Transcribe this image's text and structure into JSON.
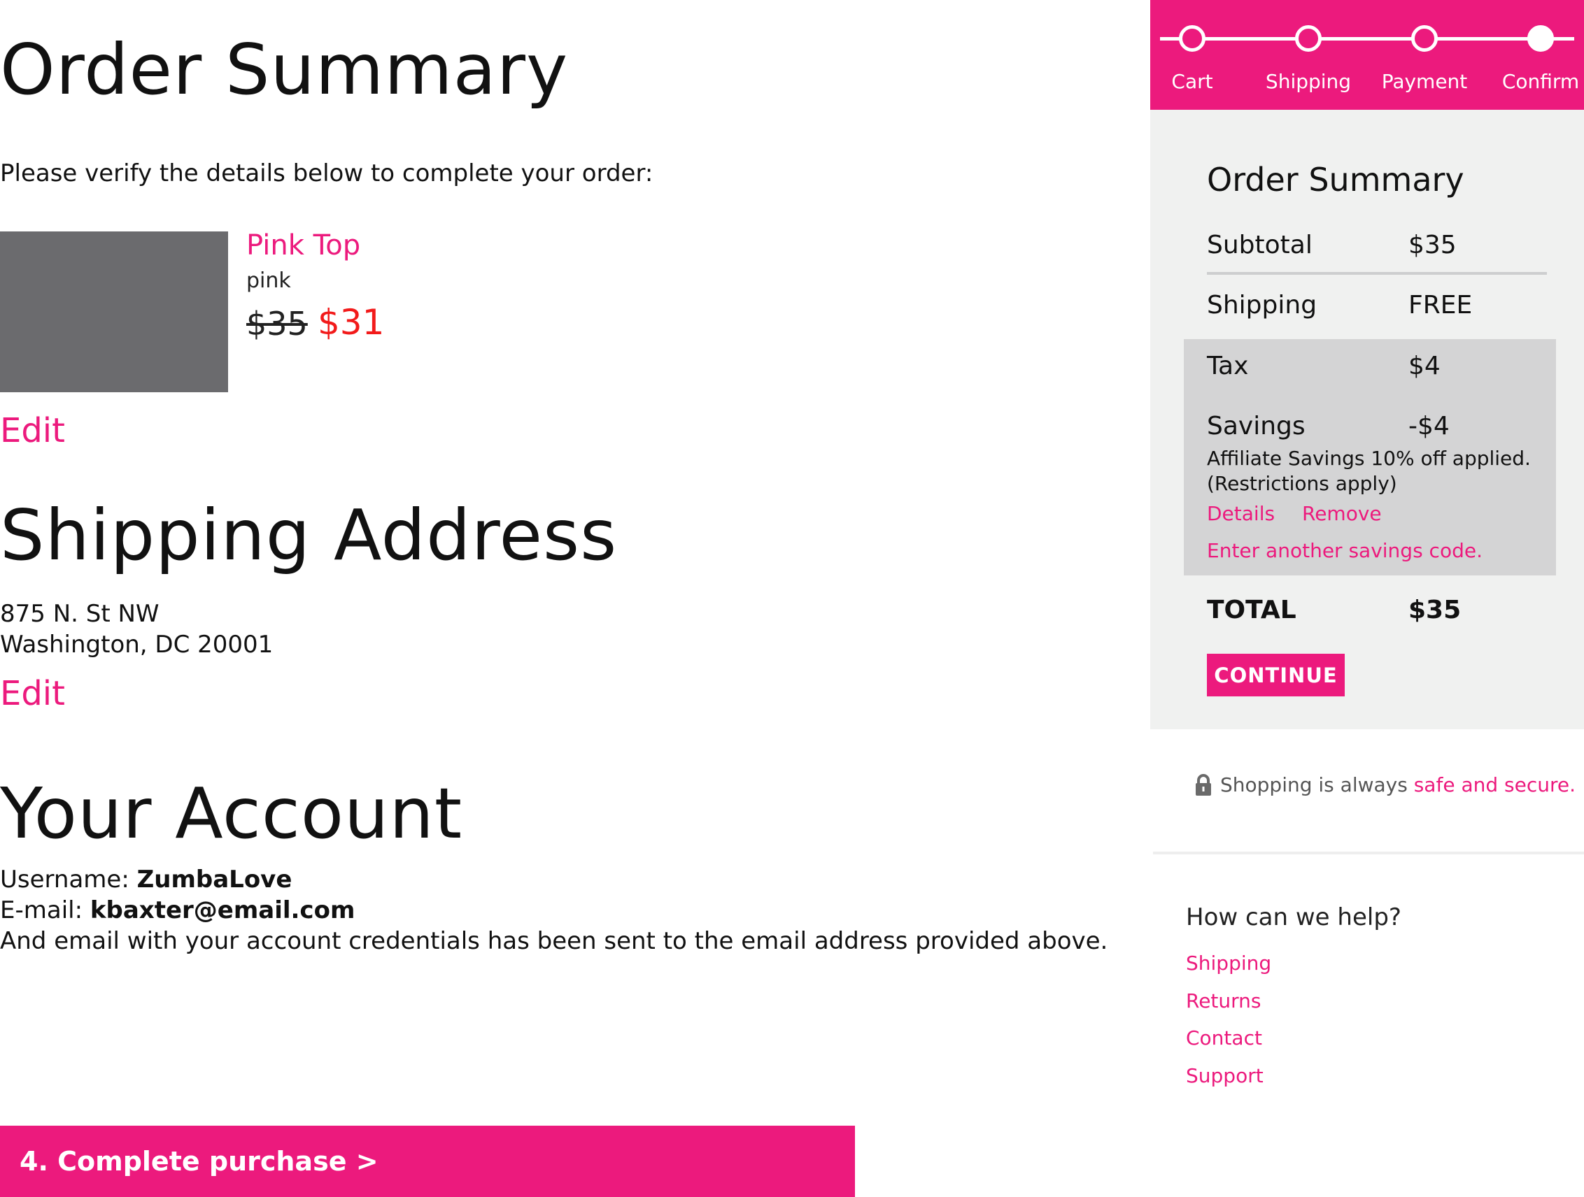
{
  "colors": {
    "accent": "#ec1a7d",
    "sale_red": "#f21a1a",
    "panel_bg": "#f0f1f0",
    "highlight_bg": "#d4d4d5",
    "thumb": "#6b6b6e"
  },
  "order": {
    "title": "Order Summary",
    "intro": "Please verify the details below to complete your order:",
    "item": {
      "name": "Pink Top",
      "variant": "pink",
      "original_price": "$35",
      "sale_price": "$31"
    },
    "edit_label": "Edit"
  },
  "shipping": {
    "title": "Shipping Address",
    "line1": "875 N. St NW",
    "line2": "Washington, DC 20001",
    "edit_label": "Edit"
  },
  "account": {
    "title": "Your Account",
    "username_label": "Username:",
    "username": "ZumbaLove",
    "email_label": "E-mail:",
    "email": "kbaxter@email.com",
    "note": "And email with your account credentials has been sent to the email address provided above."
  },
  "complete_button": "4. Complete purchase >",
  "stepper": {
    "steps": [
      {
        "label": "Cart",
        "completed": false
      },
      {
        "label": "Shipping",
        "completed": false
      },
      {
        "label": "Payment",
        "completed": false
      },
      {
        "label": "Confirm",
        "completed": true
      }
    ]
  },
  "summary": {
    "title": "Order Summary",
    "subtotal_label": "Subtotal",
    "subtotal": "$35",
    "shipping_label": "Shipping",
    "shipping": "FREE",
    "tax_label": "Tax",
    "tax": "$4",
    "savings_label": "Savings",
    "savings": "-$4",
    "savings_note_line1": "Affiliate Savings 10% off applied.",
    "savings_note_line2": "(Restrictions apply)",
    "details_link": "Details",
    "remove_link": "Remove",
    "another_code_link": "Enter another savings code.",
    "total_label": "TOTAL",
    "total": "$35",
    "continue_label": "CONTINUE"
  },
  "secure": {
    "icon": "lock-icon",
    "text": "Shopping is always ",
    "link": "safe and secure."
  },
  "help": {
    "title": "How can we help?",
    "links": [
      "Shipping",
      "Returns",
      "Contact",
      "Support"
    ]
  }
}
